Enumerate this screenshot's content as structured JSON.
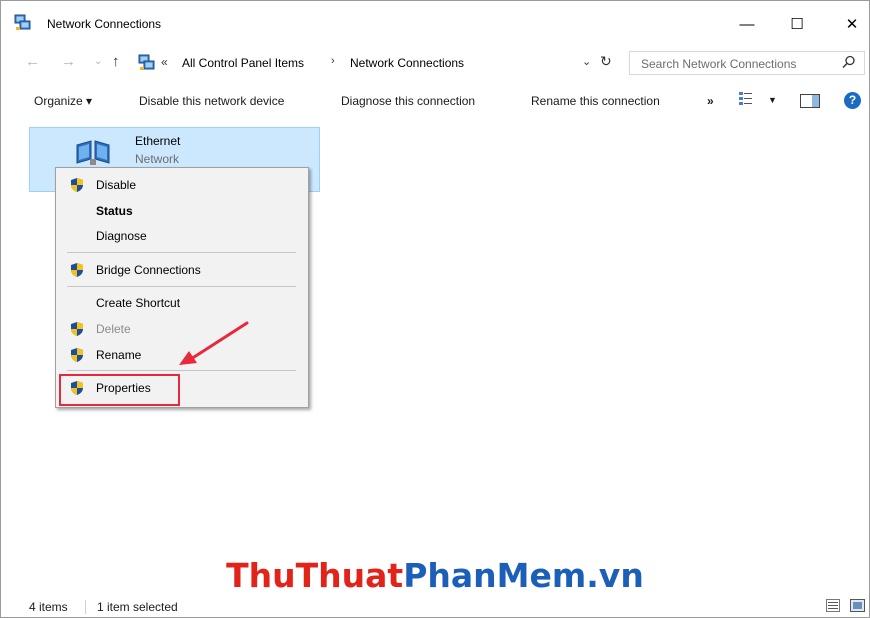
{
  "window": {
    "title": "Network Connections",
    "minimize_glyph": "—",
    "maximize_glyph": "☐",
    "close_glyph": "✕"
  },
  "address": {
    "overflow": "«",
    "crumb1": "All Control Panel Items",
    "separator": "›",
    "crumb2": "Network Connections",
    "search_placeholder": "Search Network Connections"
  },
  "toolbar": {
    "organize": "Organize ▾",
    "disable": "Disable this network device",
    "diagnose": "Diagnose this connection",
    "rename": "Rename this connection",
    "more": "»",
    "help": "?"
  },
  "item": {
    "name": "Ethernet",
    "status": "Network"
  },
  "context_menu": {
    "items": [
      {
        "label": "Disable",
        "shield": true,
        "bold": false,
        "disabled": false
      },
      {
        "label": "Status",
        "shield": false,
        "bold": true,
        "disabled": false
      },
      {
        "label": "Diagnose",
        "shield": false,
        "bold": false,
        "disabled": false
      },
      {
        "label": "Bridge Connections",
        "shield": true,
        "bold": false,
        "disabled": false
      },
      {
        "label": "Create Shortcut",
        "shield": false,
        "bold": false,
        "disabled": false
      },
      {
        "label": "Delete",
        "shield": true,
        "bold": false,
        "disabled": true
      },
      {
        "label": "Rename",
        "shield": true,
        "bold": false,
        "disabled": false
      },
      {
        "label": "Properties",
        "shield": true,
        "bold": false,
        "disabled": false
      }
    ]
  },
  "watermark": {
    "part1": "ThuThuat",
    "part2": "PhanMem",
    "part3": ".vn"
  },
  "status": {
    "count": "4 items",
    "selected": "1 item selected"
  },
  "colors": {
    "selection_bg": "#cce8ff",
    "highlight_red": "#e8283c",
    "watermark_red": "#e2231a",
    "watermark_blue": "#1c5fb8"
  },
  "icons": {
    "title": "network-connections-icon",
    "back": "arrow-left-icon",
    "forward": "arrow-right-icon",
    "up": "arrow-up-icon",
    "refresh": "refresh-icon",
    "search": "search-icon",
    "shield": "uac-shield-icon",
    "ethernet": "ethernet-adapter-icon"
  }
}
